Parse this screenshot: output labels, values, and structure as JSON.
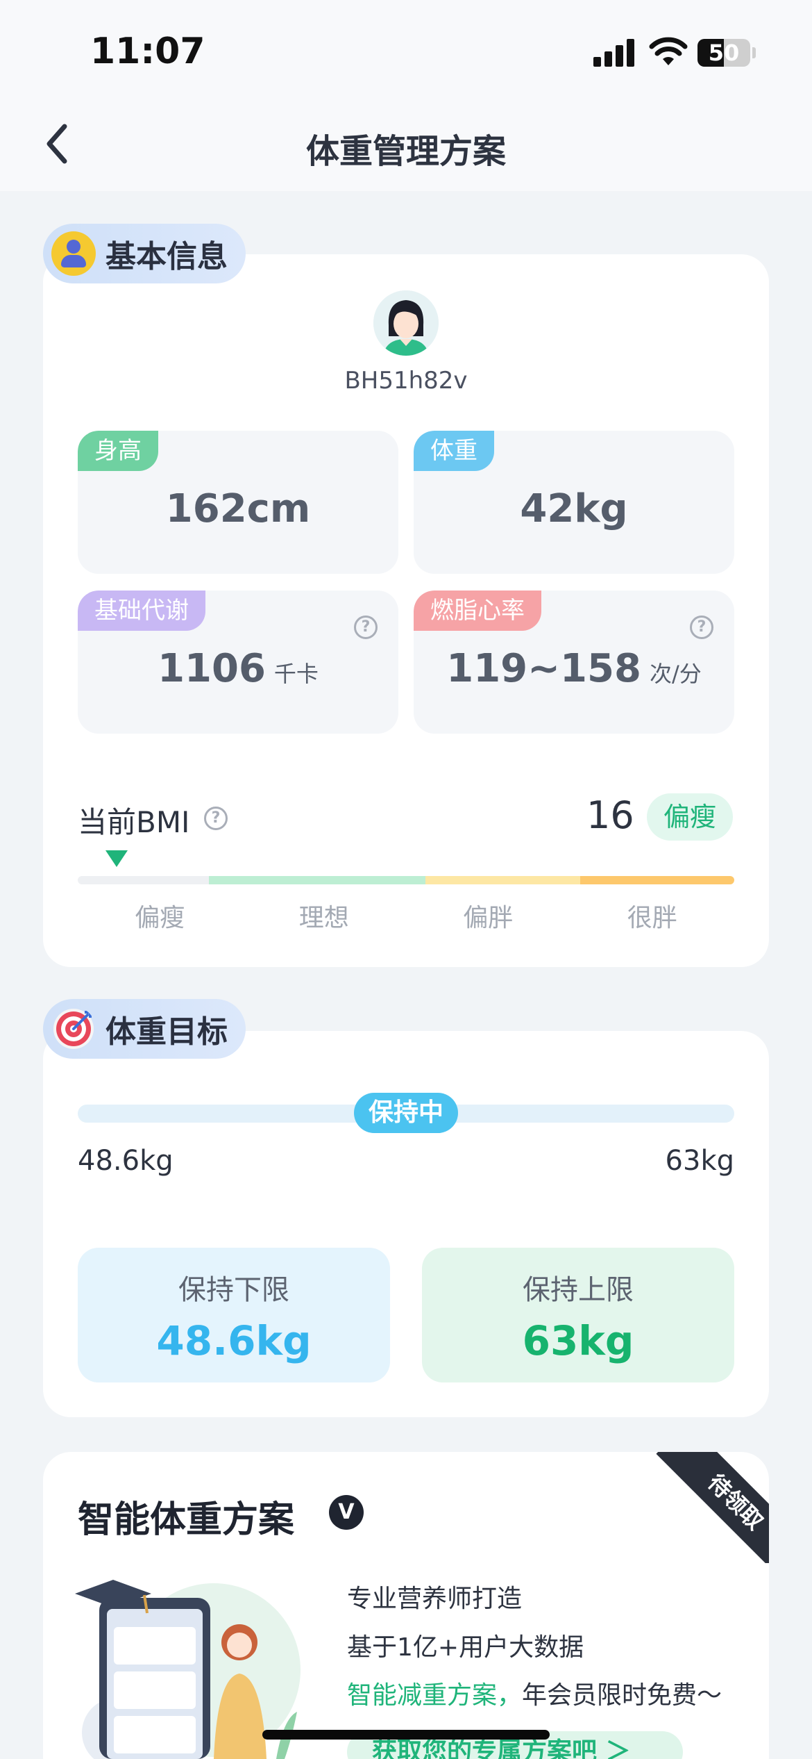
{
  "status_bar": {
    "time": "11:07",
    "battery": "50",
    "battery_level": 0.5
  },
  "nav": {
    "title": "体重管理方案"
  },
  "basic_info": {
    "section_title": "基本信息",
    "username": "BH51h82v",
    "stats": [
      {
        "label": "身高",
        "value": "162cm",
        "unit": "",
        "color": "#6fd1a1"
      },
      {
        "label": "体重",
        "value": "42kg",
        "unit": "",
        "color": "#6cc8f2"
      },
      {
        "label": "基础代谢",
        "value": "1106",
        "unit": "千卡",
        "color": "#c8b8f4"
      },
      {
        "label": "燃脂心率",
        "value": "119~158",
        "unit": "次/分",
        "color": "#f6a3a6"
      }
    ],
    "bmi": {
      "label": "当前BMI",
      "value": "16",
      "status": "偏瘦",
      "categories": [
        "偏瘦",
        "理想",
        "偏胖",
        "很胖"
      ],
      "colors": [
        "#eef0f3",
        "#bdeed3",
        "#fde7a4",
        "#fdc86c"
      ]
    }
  },
  "weight_goal": {
    "section_title": "体重目标",
    "status": "保持中",
    "min": "48.6kg",
    "max": "63kg",
    "lower": {
      "label": "保持下限",
      "value": "48.6kg",
      "color": "#35b5ee",
      "bg": "#e4f4fd"
    },
    "upper": {
      "label": "保持上限",
      "value": "63kg",
      "color": "#17b36e",
      "bg": "#e3f6ec"
    }
  },
  "smart_plan": {
    "title": "智能体重方案",
    "badge": "待领取",
    "lines": [
      "专业营养师打造",
      "基于1亿+用户大数据"
    ],
    "highlight": "智能减重方案，",
    "line3_rest": "年会员限时免费～",
    "cta": "获取您的专属方案吧 ＞"
  }
}
